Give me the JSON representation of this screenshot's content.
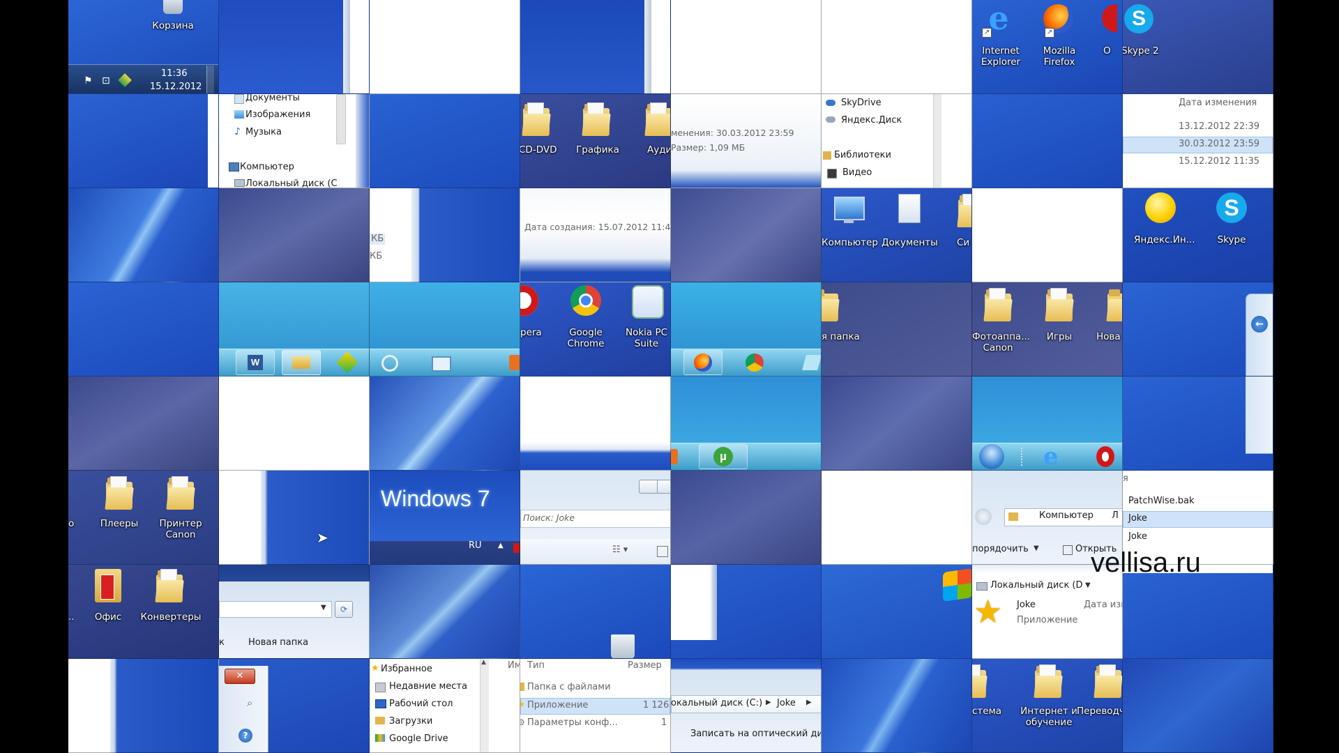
{
  "watermark": "vellisa.ru",
  "desktop": {
    "recycle_bin": "Корзина",
    "internet_explorer": "Internet Explorer",
    "mozilla_firefox": "Mozilla Firefox",
    "opera_frag": "O",
    "skype2": "Skype 2",
    "cd_dvd": "CD-DVD",
    "grafika": "Графика",
    "audio_frag": "Ауди",
    "computer": "Компьютер",
    "documents": "Документы",
    "sys_frag": "Си",
    "yandex_internet": "Яндекс.Ин...",
    "skype": "Skype",
    "opera_partial": "pera",
    "google_chrome": "Google Chrome",
    "nokia_pc_suite": "Nokia PC Suite",
    "new_folder_frag": "я папка",
    "fotoapparaty_canon": "Фотоаппа... Canon",
    "igry": "Игры",
    "nova_frag": "Нова",
    "o_frag": "о",
    "pleery": "Плееры",
    "printer_canon": "Принтер Canon",
    "ellipsis": "..",
    "ofis": "Офис",
    "konvertery": "Конвертеры",
    "sistema_frag": "стема",
    "internet_obuchenie": "Интернет и обучение",
    "perevod_frag": "Переводч"
  },
  "taskbar": {
    "time": "11:36",
    "date": "15.12.2012",
    "lang": "RU"
  },
  "explorer": {
    "nav_documents": "Документы",
    "nav_images": "Изображения",
    "nav_music": "Музыка",
    "nav_computer": "Компьютер",
    "nav_local_disk": "Локальный диск (С",
    "skydrive": "SkyDrive",
    "yandex_disk": "Яндекс.Диск",
    "libraries": "Библиотеки",
    "video": "Видео",
    "modified_label": "менения: 30.03.2012 23:59",
    "size_label": "Размер: 1,09 МБ",
    "date_modified_header": "Дата изменения",
    "dates": [
      "13.12.2012 22:39",
      "30.03.2012 23:59",
      "15.12.2012 11:35"
    ],
    "kb_1": "КБ",
    "kb_2": "КБ",
    "created_label": "Дата создания: 15.07.2012 11:48",
    "search_placeholder": "Поиск: Joke",
    "files_header_frag": "я",
    "files": [
      "PatchWise.bak",
      "Joke",
      "Joke"
    ],
    "breadcrumb_computer": "Компьютер",
    "breadcrumb_frag": "Л",
    "organize": "порядочить",
    "open": "Открыть",
    "address_local_disk_frag": "Локальный диск (С",
    "local_disk_d": "Локальный диск (D",
    "joke_name": "Joke",
    "joke_type": "Приложение",
    "date_frag": "Дата изм",
    "new_folder": "Новая папка",
    "new_folder_frag": "к",
    "favorites": "Избранное",
    "recent_places": "Недавние места",
    "desktop": "Рабочий стол",
    "downloads": "Загрузки",
    "google_drive": "Google Drive",
    "col_name_frag": "Им",
    "col_type": "Тип",
    "col_size": "Размер",
    "type_folder": "Папка с файлами",
    "type_app": "Приложение",
    "type_config": "Параметры конф...",
    "size_app": "1 126",
    "size_config": "1",
    "path_local_disk": "окальный диск (C:)",
    "path_joke": "Joke",
    "burn": "Записать на оптический дис"
  },
  "windows7_logo": "Windows 7",
  "colors": {
    "desktop_blue": "#1f4fbe",
    "dark_purple": "#3e3f72",
    "taskbar_cyan": "#3fa9d8",
    "selection": "#cfe3f8"
  }
}
